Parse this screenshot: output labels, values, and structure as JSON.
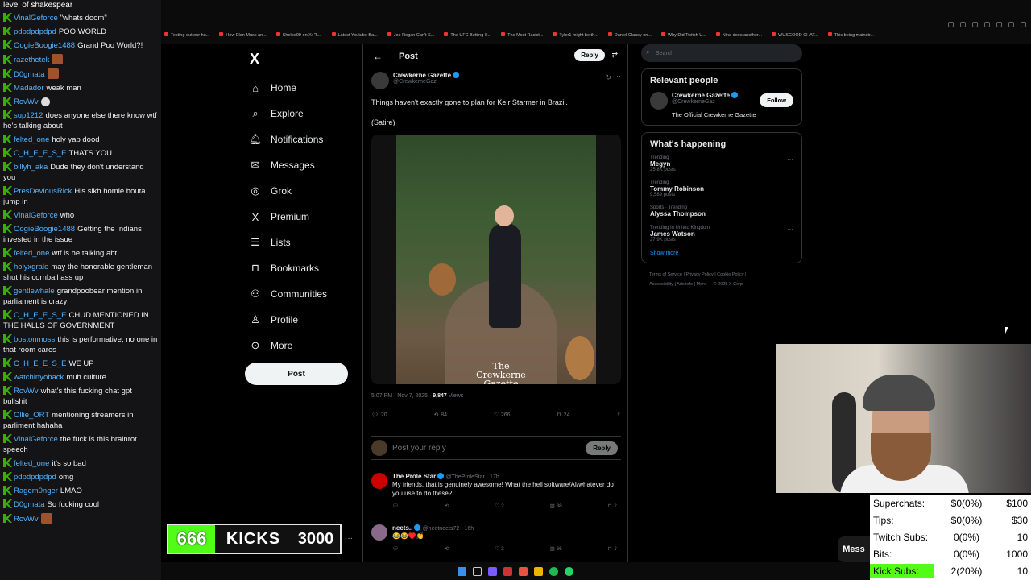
{
  "chat": {
    "header": "level of shakespear",
    "messages": [
      {
        "user": "VinalGeforce",
        "text": "\"whats doom\""
      },
      {
        "user": "pdpdpdpdpd",
        "text": "POO WORLD"
      },
      {
        "user": "OogieBoogie1488",
        "text": "Grand Poo World?!"
      },
      {
        "user": "razethetek",
        "text": "",
        "emote": "emote"
      },
      {
        "user": "D0gmata",
        "text": "",
        "emote": "emote"
      },
      {
        "user": "Madador",
        "text": "weak man"
      },
      {
        "user": "RovWv",
        "text": "",
        "emote": "skull"
      },
      {
        "user": "sup1212",
        "text": "does anyone else there know wtf he's talking about"
      },
      {
        "user": "felted_one",
        "text": "holy yap dood"
      },
      {
        "user": "C_H_E_E_S_E",
        "text": "THATS YOU"
      },
      {
        "user": "billyh_aka",
        "text": "Dude they don't understand you"
      },
      {
        "user": "PresDeviousRick",
        "text": "His sikh homie bouta jump in"
      },
      {
        "user": "VinalGeforce",
        "text": "who"
      },
      {
        "user": "OogieBoogie1488",
        "text": "Getting the Indians invested in the issue"
      },
      {
        "user": "felted_one",
        "text": "wtf is he talking abt"
      },
      {
        "user": "holyxgrale",
        "text": "may the honorable gentleman shut his cornball ass up"
      },
      {
        "user": "gentlewhale",
        "text": "grandpoobear mention in parliament is crazy"
      },
      {
        "user": "C_H_E_E_S_E",
        "text": "CHUD MENTIONED IN THE HALLS OF GOVERNMENT"
      },
      {
        "user": "bostonmoss",
        "text": "this is performative, no one in that room cares"
      },
      {
        "user": "C_H_E_E_S_E",
        "text": "WE UP"
      },
      {
        "user": "watchinyoback",
        "text": "muh culture"
      },
      {
        "user": "RovWv",
        "text": "what's this fucking chat gpt bullshit"
      },
      {
        "user": "Ollie_ORT",
        "text": "mentioning streamers in parliment hahaha"
      },
      {
        "user": "VinalGeforce",
        "text": "the fuck is this brainrot speech"
      },
      {
        "user": "felted_one",
        "text": "it's so bad"
      },
      {
        "user": "pdpdpdpdpd",
        "text": "omg"
      },
      {
        "user": "Ragem0nger",
        "text": "LMAO"
      },
      {
        "user": "D0gmata",
        "text": "So fucking cool"
      },
      {
        "user": "RovWv",
        "text": "",
        "emote": "emote"
      }
    ]
  },
  "bookmarks": [
    "Testing out our hu...",
    "How Elon Musk an...",
    "Shelbo99 on X: \"L...",
    "Latest Youtube Ba...",
    "Joe Rogan Can't S...",
    "The UFC Betting S...",
    "The Most Racist...",
    "Tyler1 might be th...",
    "Daniel Clancy on...",
    "Why Did Twitch U...",
    "Nina does another...",
    "WUSGOOD CHAT...",
    "This being mainstr..."
  ],
  "nav": {
    "logo": "X",
    "items": [
      {
        "icon": "⌂",
        "label": "Home"
      },
      {
        "icon": "⌕",
        "label": "Explore"
      },
      {
        "icon": "🔔︎",
        "label": "Notifications"
      },
      {
        "icon": "✉",
        "label": "Messages"
      },
      {
        "icon": "◎",
        "label": "Grok"
      },
      {
        "icon": "X",
        "label": "Premium"
      },
      {
        "icon": "☰",
        "label": "Lists"
      },
      {
        "icon": "⊓",
        "label": "Bookmarks"
      },
      {
        "icon": "⚇",
        "label": "Communities"
      },
      {
        "icon": "♙",
        "label": "Profile"
      },
      {
        "icon": "⊙",
        "label": "More"
      }
    ],
    "post_button": "Post"
  },
  "post": {
    "header_title": "Post",
    "reply_button": "Reply",
    "author_name": "Crewkerne Gazette",
    "author_handle": "@CrewkerneGaz",
    "text": "Things haven't exactly gone to plan for Keir Starmer in Brazil.",
    "tag": "(Satire)",
    "watermark_line1": "The",
    "watermark_line2": "Crewkerne Gazette",
    "time": "5:07 PM · Nov 7, 2025 · ",
    "views_count": "9,847",
    "views_label": " Views",
    "replies": "20",
    "reposts": "84",
    "likes": "266",
    "bookmarks": "24",
    "reply_placeholder": "Post your reply",
    "reply_submit": "Reply"
  },
  "comments": [
    {
      "name": "The Prole Star",
      "handle": "@TheProleStar · 17h",
      "text": "My friends, that is genuinely awesome! What the hell software/AI/whatever do you use to do these?",
      "likes": "2",
      "views": "88"
    },
    {
      "name": "neets..",
      "handle": "@neetneets72 · 16h",
      "text": "😂😂♥️👏",
      "likes": "3",
      "views": "66"
    }
  ],
  "sidebar": {
    "search_placeholder": "Search",
    "relevant_title": "Relevant people",
    "person_name": "Crewkerne Gazette",
    "person_handle": "@CrewkerneGaz",
    "follow": "Follow",
    "person_bio": "The Official Crewkerne Gazette",
    "happening_title": "What's happening",
    "trends": [
      {
        "meta": "Trending",
        "name": "Megyn",
        "count": "25.8K posts"
      },
      {
        "meta": "Trending",
        "name": "Tommy Robinson",
        "count": "9,589 posts"
      },
      {
        "meta": "Sports · Trending",
        "name": "Alyssa Thompson",
        "count": ""
      },
      {
        "meta": "Trending in United Kingdom",
        "name": "James Watson",
        "count": "27.9K posts"
      }
    ],
    "show_more": "Show more",
    "footer_line1": "Terms of Service  |  Privacy Policy  |  Cookie Policy  |",
    "footer_line2": "Accessibility  |  Ads info  |  More ···  © 2025 X Corp."
  },
  "kicks": {
    "current": "666",
    "label": "KICKS",
    "goal": "3000"
  },
  "messages_tab": "Mess",
  "stats": [
    {
      "key": "Superchats:",
      "value": "$0(0%)",
      "goal": "$100"
    },
    {
      "key": "Tips:",
      "value": "$0(0%)",
      "goal": "$30"
    },
    {
      "key": "Twitch Subs:",
      "value": "0(0%)",
      "goal": "10"
    },
    {
      "key": "Bits:",
      "value": "0(0%)",
      "goal": "1000"
    },
    {
      "key": "Kick Subs:",
      "value": "2(20%)",
      "goal": "10"
    }
  ],
  "colors": {
    "kick_green": "#53fc18",
    "x_blue": "#1d9bf0",
    "chat_user": "#53b3ff"
  }
}
